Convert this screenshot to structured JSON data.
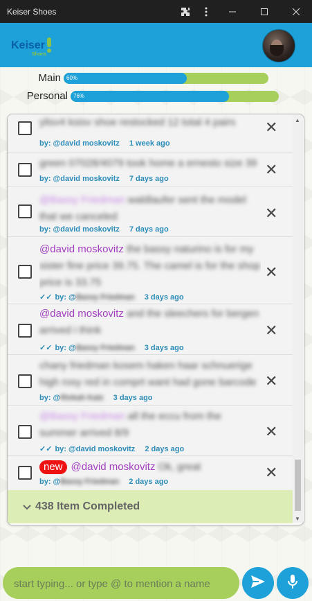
{
  "window": {
    "title": "Keiser Shoes",
    "extension_icon": "puzzle-icon",
    "menu_icon": "kebab-icon",
    "minimize_icon": "minimize-icon",
    "maximize_icon": "maximize-icon",
    "close_icon": "close-icon"
  },
  "header": {
    "logo_text": "Keiser",
    "logo_sub": "Shoes",
    "bg_color": "#1da1d8"
  },
  "progress": [
    {
      "label": "Main",
      "percent_text": "60%",
      "value": 60
    },
    {
      "label": "Personal",
      "percent_text": "76%",
      "value": 76
    }
  ],
  "tasks": [
    {
      "text_blurred": "ylisv4 ksisv shoe restocked 12 total 4 pairs home",
      "by": "by: @david moskovitz",
      "when": "1 week ago"
    },
    {
      "text_blurred": "green 07028/4079 took home a ernesto size 39",
      "by": "by: @david moskovitz",
      "when": "7 days ago"
    },
    {
      "mention": "@Bassy Friedman",
      "mention_blurred": true,
      "text_blurred": "waldlaufer sent the model that we canceled",
      "by": "by: @david moskovitz",
      "when": "7 days ago"
    },
    {
      "mention": "@david moskovitz",
      "text_blurred": "the bassy naturino is for my sister fine price 39.75. The camel is for the shop price is 33.75",
      "by_prefix": "by: @",
      "by_blurred": "Bassy Friedman",
      "when": "3 days ago",
      "read": true
    },
    {
      "mention": "@david moskovitz",
      "text_blurred": "and the sleechers for bergen arrived i think",
      "by_prefix": "by: @",
      "by_blurred": "Bassy Friedman",
      "when": "3 days ago",
      "read": true
    },
    {
      "text_blurred": "chany friedman kosem haken haar schnuerige high rosy red in comprt want had gone barcode",
      "by_prefix": "by: @",
      "by_blurred": "Rivkah Katz",
      "when": "3 days ago"
    },
    {
      "mention": "@Bassy Friedman",
      "mention_blurred": true,
      "text_blurred": "all the eccu from the summer arrived 8/9",
      "by": "by: @david moskovitz",
      "when": "2 days ago",
      "read": true
    },
    {
      "new_badge": "new",
      "mention": "@david moskovitz",
      "text_blurred": "Ok, great",
      "by_prefix": "by: @",
      "by_blurred": "Bassy Friedman",
      "when": "2 days ago"
    }
  ],
  "completed": {
    "label": "438 Item Completed",
    "icon": "chevron-down-icon",
    "bg_color": "#dcedb5"
  },
  "composer": {
    "placeholder": "start typing... or type @ to mention a name",
    "send_icon": "send-icon",
    "mic_icon": "microphone-icon"
  }
}
